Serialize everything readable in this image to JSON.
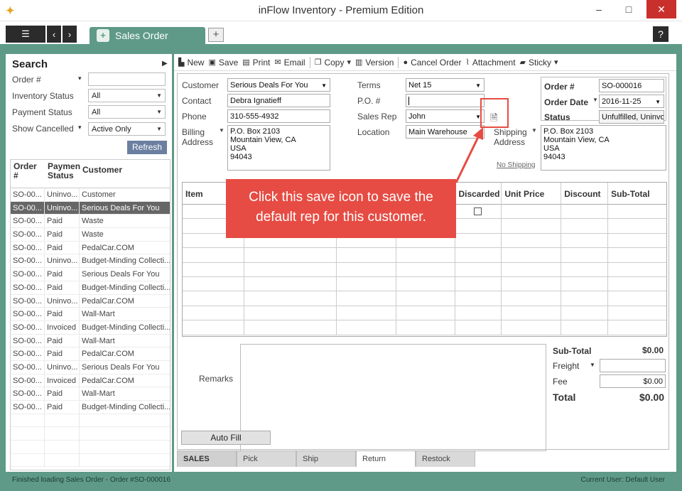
{
  "window": {
    "title": "inFlow Inventory - Premium Edition",
    "min": "–",
    "max": "□",
    "close": "✕"
  },
  "tabbar": {
    "active_tab": "Sales Order",
    "add": "+",
    "help": "?"
  },
  "search": {
    "heading": "Search",
    "fields": [
      {
        "label": "Order #",
        "value": ""
      },
      {
        "label": "Inventory Status",
        "value": "All"
      },
      {
        "label": "Payment Status",
        "value": "All"
      },
      {
        "label": "Show Cancelled",
        "value": "Active Only"
      }
    ],
    "refresh": "Refresh"
  },
  "orderlist": {
    "headers": [
      "Order #",
      "Paymen Status",
      "Customer"
    ],
    "rows": [
      [
        "SO-00...",
        "Uninvo...",
        "Customer"
      ],
      [
        "SO-00...",
        "Uninvo...",
        "Serious Deals For You"
      ],
      [
        "SO-00...",
        "Paid",
        "Waste"
      ],
      [
        "SO-00...",
        "Paid",
        "Waste"
      ],
      [
        "SO-00...",
        "Paid",
        "PedalCar.COM"
      ],
      [
        "SO-00...",
        "Uninvo...",
        "Budget-Minding Collecti..."
      ],
      [
        "SO-00...",
        "Paid",
        "Serious Deals For You"
      ],
      [
        "SO-00...",
        "Paid",
        "Budget-Minding Collecti..."
      ],
      [
        "SO-00...",
        "Uninvo...",
        "PedalCar.COM"
      ],
      [
        "SO-00...",
        "Paid",
        "Wall-Mart"
      ],
      [
        "SO-00...",
        "Invoiced",
        "Budget-Minding Collecti..."
      ],
      [
        "SO-00...",
        "Paid",
        "Wall-Mart"
      ],
      [
        "SO-00...",
        "Paid",
        "PedalCar.COM"
      ],
      [
        "SO-00...",
        "Uninvo...",
        "Serious Deals For You"
      ],
      [
        "SO-00...",
        "Invoiced",
        "PedalCar.COM"
      ],
      [
        "SO-00...",
        "Paid",
        "Wall-Mart"
      ],
      [
        "SO-00...",
        "Paid",
        "Budget-Minding Collecti..."
      ],
      [
        "",
        "",
        ""
      ],
      [
        "",
        "",
        ""
      ],
      [
        "",
        "",
        ""
      ],
      [
        "",
        "",
        ""
      ]
    ]
  },
  "toolbar": {
    "new": "New",
    "save": "Save",
    "print": "Print",
    "email": "Email",
    "copy": "Copy",
    "version": "Version",
    "cancel_order": "Cancel Order",
    "attachment": "Attachment",
    "sticky": "Sticky"
  },
  "order": {
    "customer_label": "Customer",
    "customer": "Serious Deals For You",
    "contact_label": "Contact",
    "contact": "Debra Ignatieff",
    "phone_label": "Phone",
    "phone": "310-555-4932",
    "billing_label1": "Billing",
    "billing_label2": "Address",
    "billing": [
      "P.O. Box 2103",
      "Mountain View, CA",
      "USA",
      "94043"
    ],
    "terms_label": "Terms",
    "terms": "Net 15",
    "po_label": "P.O. #",
    "po": "",
    "rep_label": "Sales Rep",
    "rep": "John",
    "location_label": "Location",
    "location": "Main Warehouse",
    "shipping_label1": "Shipping",
    "shipping_label2": "Address",
    "shipping": [
      "P.O. Box 2103",
      "Mountain View, CA",
      "USA",
      "94043"
    ],
    "no_shipping": "No Shipping",
    "order_no_label": "Order #",
    "order_no": "SO-000016",
    "order_date_label": "Order Date",
    "order_date": "2016-11-25",
    "status_label": "Status",
    "status": "Unfulfilled, Uninvoic"
  },
  "items": {
    "headers": [
      "Item",
      "",
      "",
      "",
      "Discarded",
      "Unit Price",
      "Discount",
      "Sub-Total"
    ]
  },
  "totals": {
    "remarks_label": "Remarks",
    "subtotal_label": "Sub-Total",
    "subtotal": "$0.00",
    "freight_label": "Freight",
    "fee_label": "Fee",
    "fee": "$0.00",
    "total_label": "Total",
    "total": "$0.00"
  },
  "autofill": "Auto Fill",
  "bottom_tabs": [
    "SALES",
    "Pick",
    "Ship",
    "Return",
    "Restock"
  ],
  "status": {
    "left": "Finished loading Sales Order - Order #SO-000016",
    "right": "Current User:  Default User"
  },
  "callout": {
    "line1": "Click this save icon to save the",
    "line2": "default rep for this customer."
  }
}
